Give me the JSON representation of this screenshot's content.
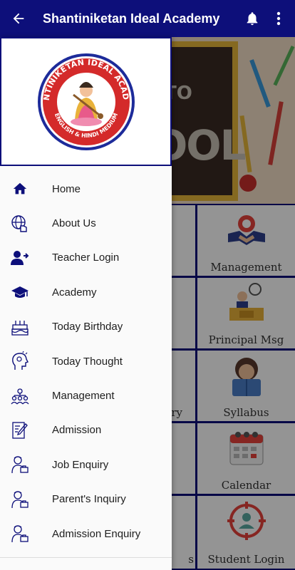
{
  "appbar": {
    "title": "Shantiniketan Ideal Academy",
    "back_icon": "arrow-left-icon",
    "bell_icon": "bell-icon",
    "more_icon": "more-vertical-icon"
  },
  "colors": {
    "primary": "#0d0f7a",
    "logo_red": "#d42a2a",
    "logo_blue": "#1d2b9a"
  },
  "drawer": {
    "logo": {
      "ring_text": "SHANTINIKETAN IDEAL ACADEMY",
      "bottom_text": "ENGLISH & HINDI MEDIUM"
    },
    "items": [
      {
        "label": "Home",
        "icon": "home-icon"
      },
      {
        "label": "About Us",
        "icon": "globe-hand-icon"
      },
      {
        "label": "Teacher Login",
        "icon": "user-login-icon"
      },
      {
        "label": "Academy",
        "icon": "graduation-cap-icon"
      },
      {
        "label": "Today Birthday",
        "icon": "birthday-cake-icon"
      },
      {
        "label": "Today Thought",
        "icon": "head-idea-icon"
      },
      {
        "label": "Management",
        "icon": "team-hierarchy-icon"
      },
      {
        "label": "Admission",
        "icon": "admission-form-icon"
      },
      {
        "label": "Job Enquiry",
        "icon": "person-briefcase-icon"
      },
      {
        "label": "Parent's Inquiry",
        "icon": "person-briefcase-icon"
      },
      {
        "label": "Admission Enquiry",
        "icon": "person-briefcase-icon"
      }
    ]
  },
  "main": {
    "banner_text": {
      "to": "TO",
      "ool": "OOL"
    },
    "tiles_right": [
      {
        "label": "Management",
        "icon": "handshake-icon"
      },
      {
        "label": "Principal Msg",
        "icon": "principal-desk-icon"
      },
      {
        "label": "Syllabus",
        "icon": "student-reading-icon"
      },
      {
        "label": "Calendar",
        "icon": "calendar-icon"
      },
      {
        "label": "Student Login",
        "icon": "target-user-icon"
      }
    ],
    "tiles_left_partial": [
      {
        "label": ""
      },
      {
        "label": ""
      },
      {
        "label": "ry"
      },
      {
        "label": ""
      },
      {
        "label": "s"
      }
    ]
  }
}
